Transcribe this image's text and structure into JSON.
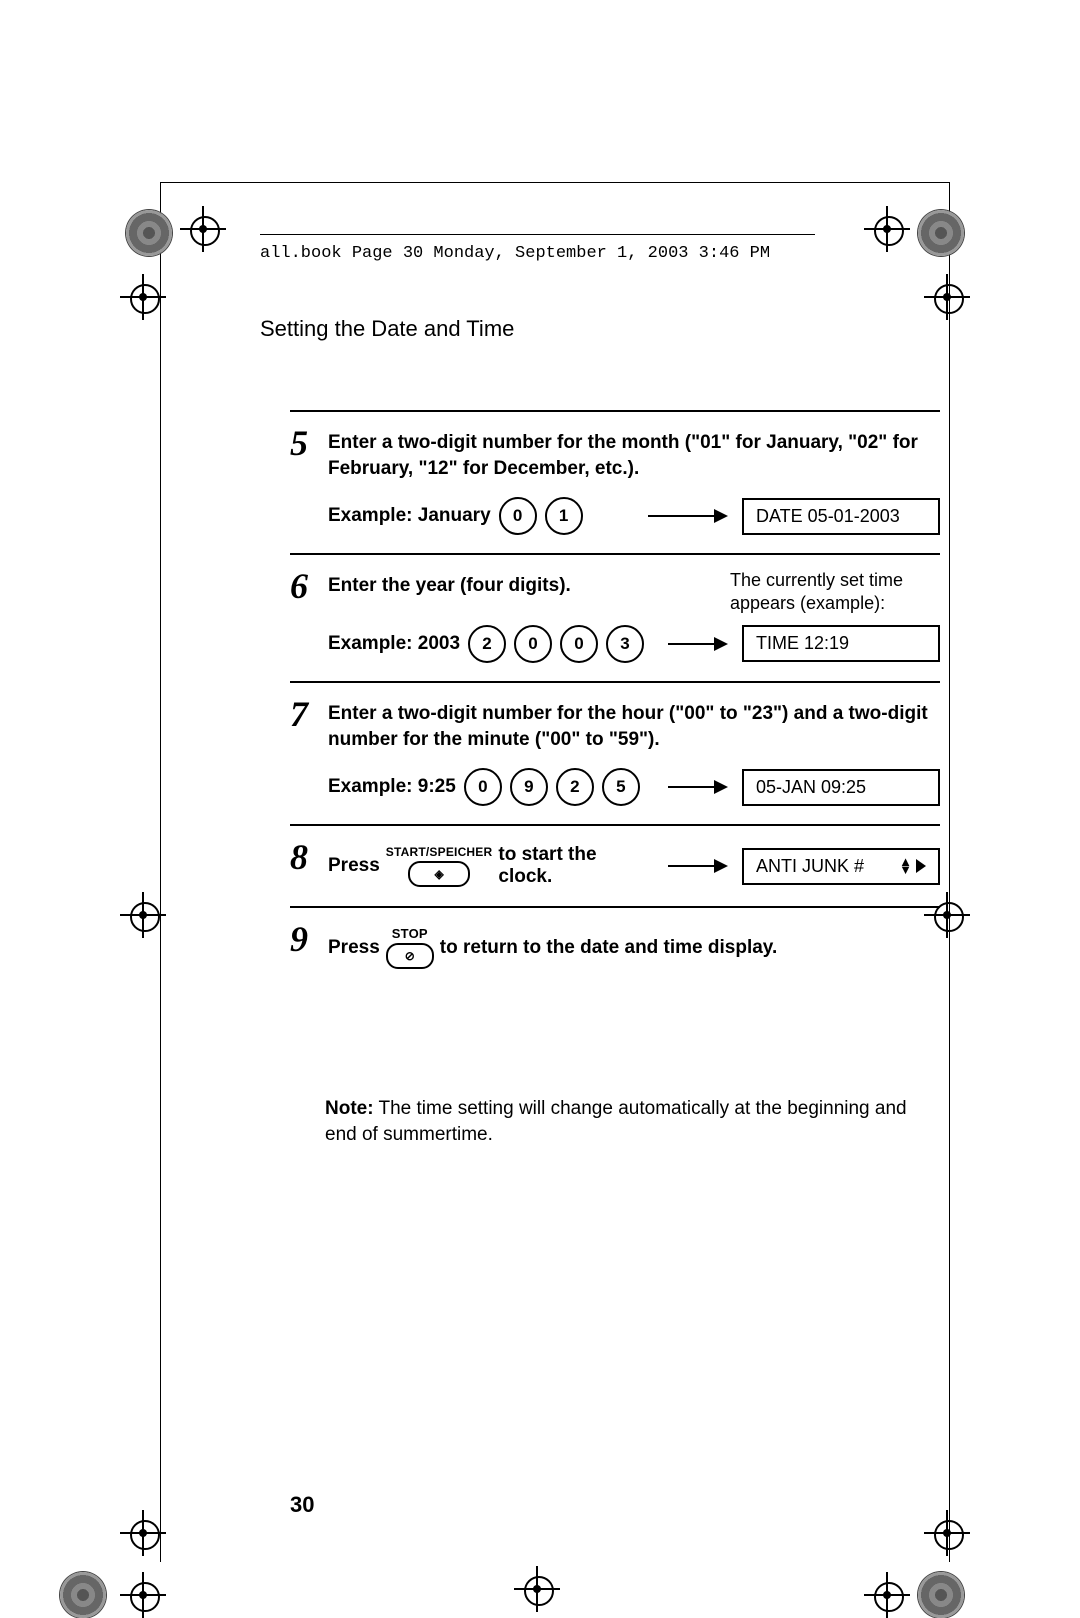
{
  "header": {
    "crop_text": "all.book  Page 30  Monday, September 1, 2003  3:46 PM"
  },
  "section_title": "Setting the Date and Time",
  "steps": {
    "s5": {
      "num": "5",
      "instr": "Enter a two-digit number for the month (\"01\" for January, \"02\" for February, \"12\" for December, etc.).",
      "example_label": "Example: January",
      "keys": [
        "0",
        "1"
      ],
      "display": "DATE 05-01-2003"
    },
    "s6": {
      "num": "6",
      "instr": "Enter the year (four digits).",
      "side_note_l1": "The currently set time",
      "side_note_l2": "appears (example):",
      "example_label": "Example: 2003",
      "keys": [
        "2",
        "0",
        "0",
        "3"
      ],
      "display": "TIME 12:19"
    },
    "s7": {
      "num": "7",
      "instr": "Enter a two-digit number for the hour (\"00\" to \"23\") and a two-digit number for the minute (\"00\" to \"59\").",
      "example_label": "Example: 9:25",
      "keys": [
        "0",
        "9",
        "2",
        "5"
      ],
      "display": "05-JAN 09:25"
    },
    "s8": {
      "num": "8",
      "press": "Press",
      "button_label": "START/SPEICHER",
      "after": " to start the clock.",
      "display": "ANTI JUNK #"
    },
    "s9": {
      "num": "9",
      "press": "Press",
      "button_label": "STOP",
      "after": " to return to the date and time display."
    }
  },
  "note": {
    "prefix": "Note:",
    "text": " The time setting will change automatically at the beginning and end of summertime."
  },
  "page_number": "30",
  "icons": {
    "button_glyph": "◈",
    "stop_glyph": "⊘"
  }
}
